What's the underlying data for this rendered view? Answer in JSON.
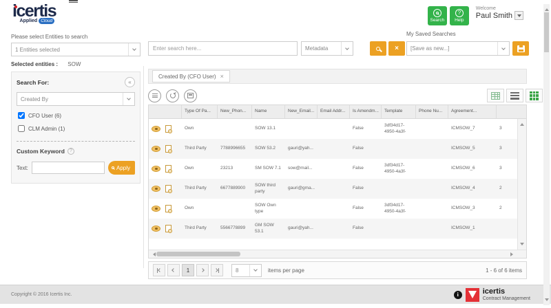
{
  "header": {
    "logo_text": "icertis",
    "logo_tagline": "Applied",
    "logo_tagline_badge": "Cloud",
    "search_button_label": "Search",
    "help_button_label": "Help",
    "welcome_label": "Welcome",
    "user_name": "Paul Smith"
  },
  "entities": {
    "select_label": "Please select Entities to search",
    "dropdown_value": "1 Entities selected",
    "selected_label": "Selected entities :",
    "selected_value": "SOW"
  },
  "search_for": {
    "title": "Search For:",
    "dropdown_value": "Created By",
    "options": [
      {
        "label": "CFO User (6)",
        "checked": true
      },
      {
        "label": "CLM Admin (1)",
        "checked": false
      }
    ],
    "custom_keyword_label": "Custom Keyword",
    "text_label": "Text:",
    "text_value": "",
    "apply_label": "Apply"
  },
  "searchbar": {
    "placeholder": "Enter search here...",
    "scope_value": "Metadata"
  },
  "saved": {
    "label": "My Saved Searches",
    "dropdown_value": "[Save as new...]"
  },
  "chip": {
    "label": "Created By (CFO User)"
  },
  "table": {
    "columns": [
      "Type Of Pa...",
      "New_Phon...",
      "Name",
      "New_Email...",
      "Email Addr...",
      "Is Amendm...",
      "Template",
      "Phone Nu...",
      "Agreement..."
    ],
    "rows": [
      {
        "cells": [
          "Own",
          "",
          "SOW 13.1",
          "",
          "",
          "False",
          "3df34d17-4950-4a3f-",
          "",
          "ICMSOW_7",
          "3"
        ]
      },
      {
        "cells": [
          "Third Party",
          "7788996655",
          "SOW 53.2",
          "gauri@yah...",
          "",
          "False",
          "",
          "",
          "ICMSOW_5",
          "3"
        ]
      },
      {
        "cells": [
          "Own",
          "23213",
          "SM SOW 7.1",
          "sow@mail...",
          "",
          "False",
          "3df34d17-4950-4a3f-",
          "",
          "ICMSOW_6",
          "3"
        ]
      },
      {
        "cells": [
          "Third Party",
          "6677889900",
          "SOW third party",
          "gauri@gma...",
          "",
          "False",
          "",
          "",
          "ICMSOW_4",
          "2"
        ]
      },
      {
        "cells": [
          "Own",
          "",
          "SOW Own type",
          "",
          "",
          "False",
          "3df34d17-4950-4a3f-",
          "",
          "ICMSOW_3",
          "2"
        ]
      },
      {
        "cells": [
          "Third Party",
          "5566778899",
          "GM SOW 53.1",
          "gauri@yah...",
          "",
          "False",
          "",
          "",
          "ICMSOW_1",
          ""
        ]
      }
    ]
  },
  "pagination": {
    "current_page": "1",
    "page_size": "8",
    "items_per_page_label": "items per page",
    "range_label": "1 - 6 of 6 items"
  },
  "footer": {
    "copyright": "Copyright © 2016 Icertis Inc.",
    "logo_text": "icertis",
    "logo_subtext": "Contract Management"
  },
  "icons": {
    "question_mark": "?",
    "collapse": "«",
    "clear": "×",
    "chip_close": "×",
    "info": "i"
  },
  "colors": {
    "accent_orange": "#eca123",
    "accent_green": "#33b34a",
    "brand_navy": "#1d2a4a",
    "brand_red": "#e43137"
  }
}
